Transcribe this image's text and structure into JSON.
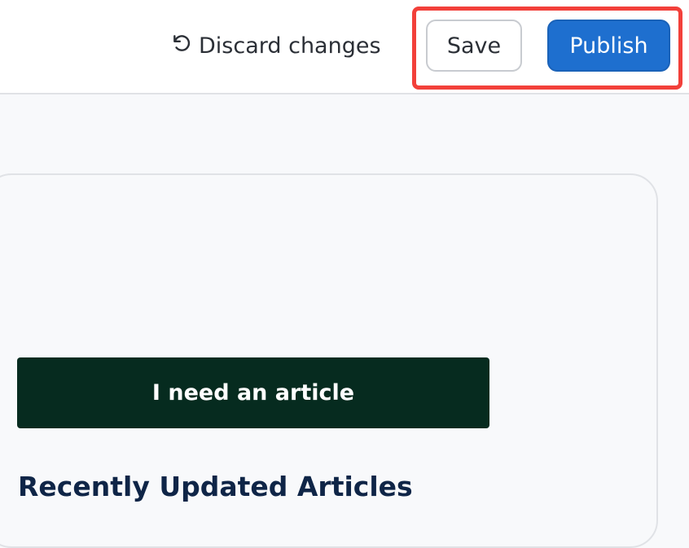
{
  "toolbar": {
    "discard_label": "Discard changes",
    "discard_icon": "undo-icon",
    "save_label": "Save",
    "publish_label": "Publish"
  },
  "colors": {
    "publish_bg": "#1e6fcf",
    "cta_bg": "#062b1f",
    "heading": "#0f2547",
    "highlight": "#f2403a"
  },
  "main": {
    "cta_label": "I need an article",
    "section_heading": "Recently Updated Articles"
  }
}
